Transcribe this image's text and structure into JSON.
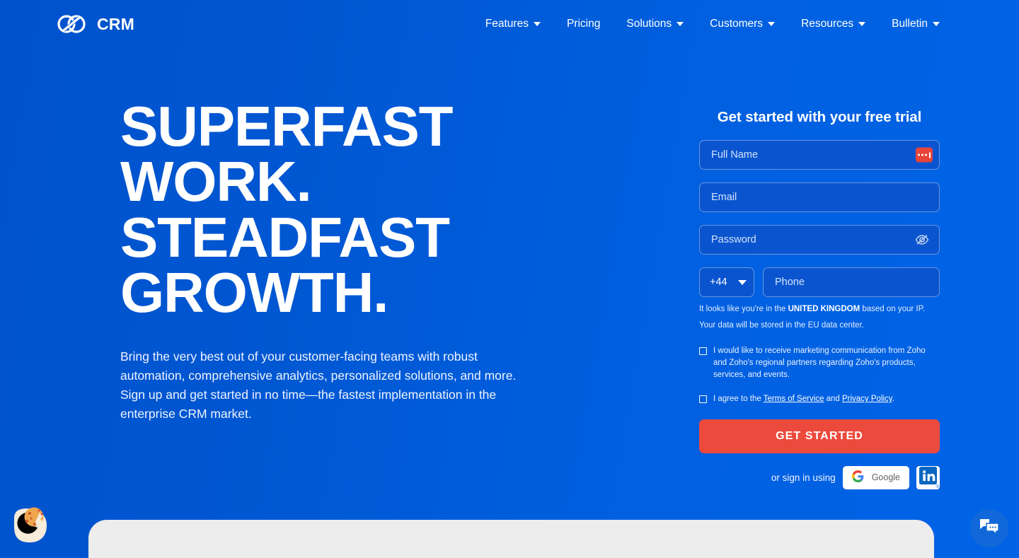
{
  "brand": {
    "name": "CRM",
    "logo_icon": "zoho-infinity-logo-icon"
  },
  "nav": {
    "items": [
      {
        "label": "Features",
        "has_dropdown": true
      },
      {
        "label": "Pricing",
        "has_dropdown": false
      },
      {
        "label": "Solutions",
        "has_dropdown": true
      },
      {
        "label": "Customers",
        "has_dropdown": true
      },
      {
        "label": "Resources",
        "has_dropdown": true
      },
      {
        "label": "Bulletin",
        "has_dropdown": true
      }
    ]
  },
  "hero": {
    "title_lines": [
      "SUPERFAST",
      "WORK.",
      "STEADFAST",
      "GROWTH."
    ],
    "subtitle": "Bring the very best out of your customer-facing teams with robust automation, comprehensive analytics, personalized solutions, and more. Sign up and get started in no time—the fastest implementation in the enterprise CRM market."
  },
  "signup": {
    "title": "Get started with your free trial",
    "fields": {
      "full_name_placeholder": "Full Name",
      "email_placeholder": "Email",
      "password_placeholder": "Password",
      "phone_placeholder": "Phone",
      "country_code": "+44"
    },
    "icons": {
      "password_manager": "password-manager-icon",
      "password_visibility": "eye-slash-icon",
      "country_dropdown": "chevron-down-icon"
    },
    "ip_note_prefix": "It looks like you're in the ",
    "ip_note_country": "UNITED KINGDOM",
    "ip_note_suffix": " based on your IP.",
    "data_center_note": "Your data will be stored in the EU data center.",
    "consent_marketing": "I would like to receive marketing communication from Zoho and Zoho's regional partners regarding Zoho's products, services, and events.",
    "consent_terms_prefix": "I agree to the ",
    "terms_link": "Terms of Service",
    "consent_terms_middle": " and ",
    "privacy_link": "Privacy Policy",
    "consent_terms_suffix": ".",
    "cta_label": "GET STARTED",
    "social_label": "or sign in using",
    "google_label": "Google",
    "google_icon": "google-g-icon",
    "linkedin_icon": "linkedin-in-icon"
  },
  "widgets": {
    "cookie_icon": "cookie-consent-icon",
    "chat_icon": "chat-bubbles-icon"
  },
  "colors": {
    "background_blue": "#0057d2",
    "accent_red": "#ec4a3d",
    "field_blue": "#0a55cf",
    "panel_gray": "#ededed",
    "google_blue": "#4285F4",
    "linkedin_blue": "#0a66c2"
  }
}
